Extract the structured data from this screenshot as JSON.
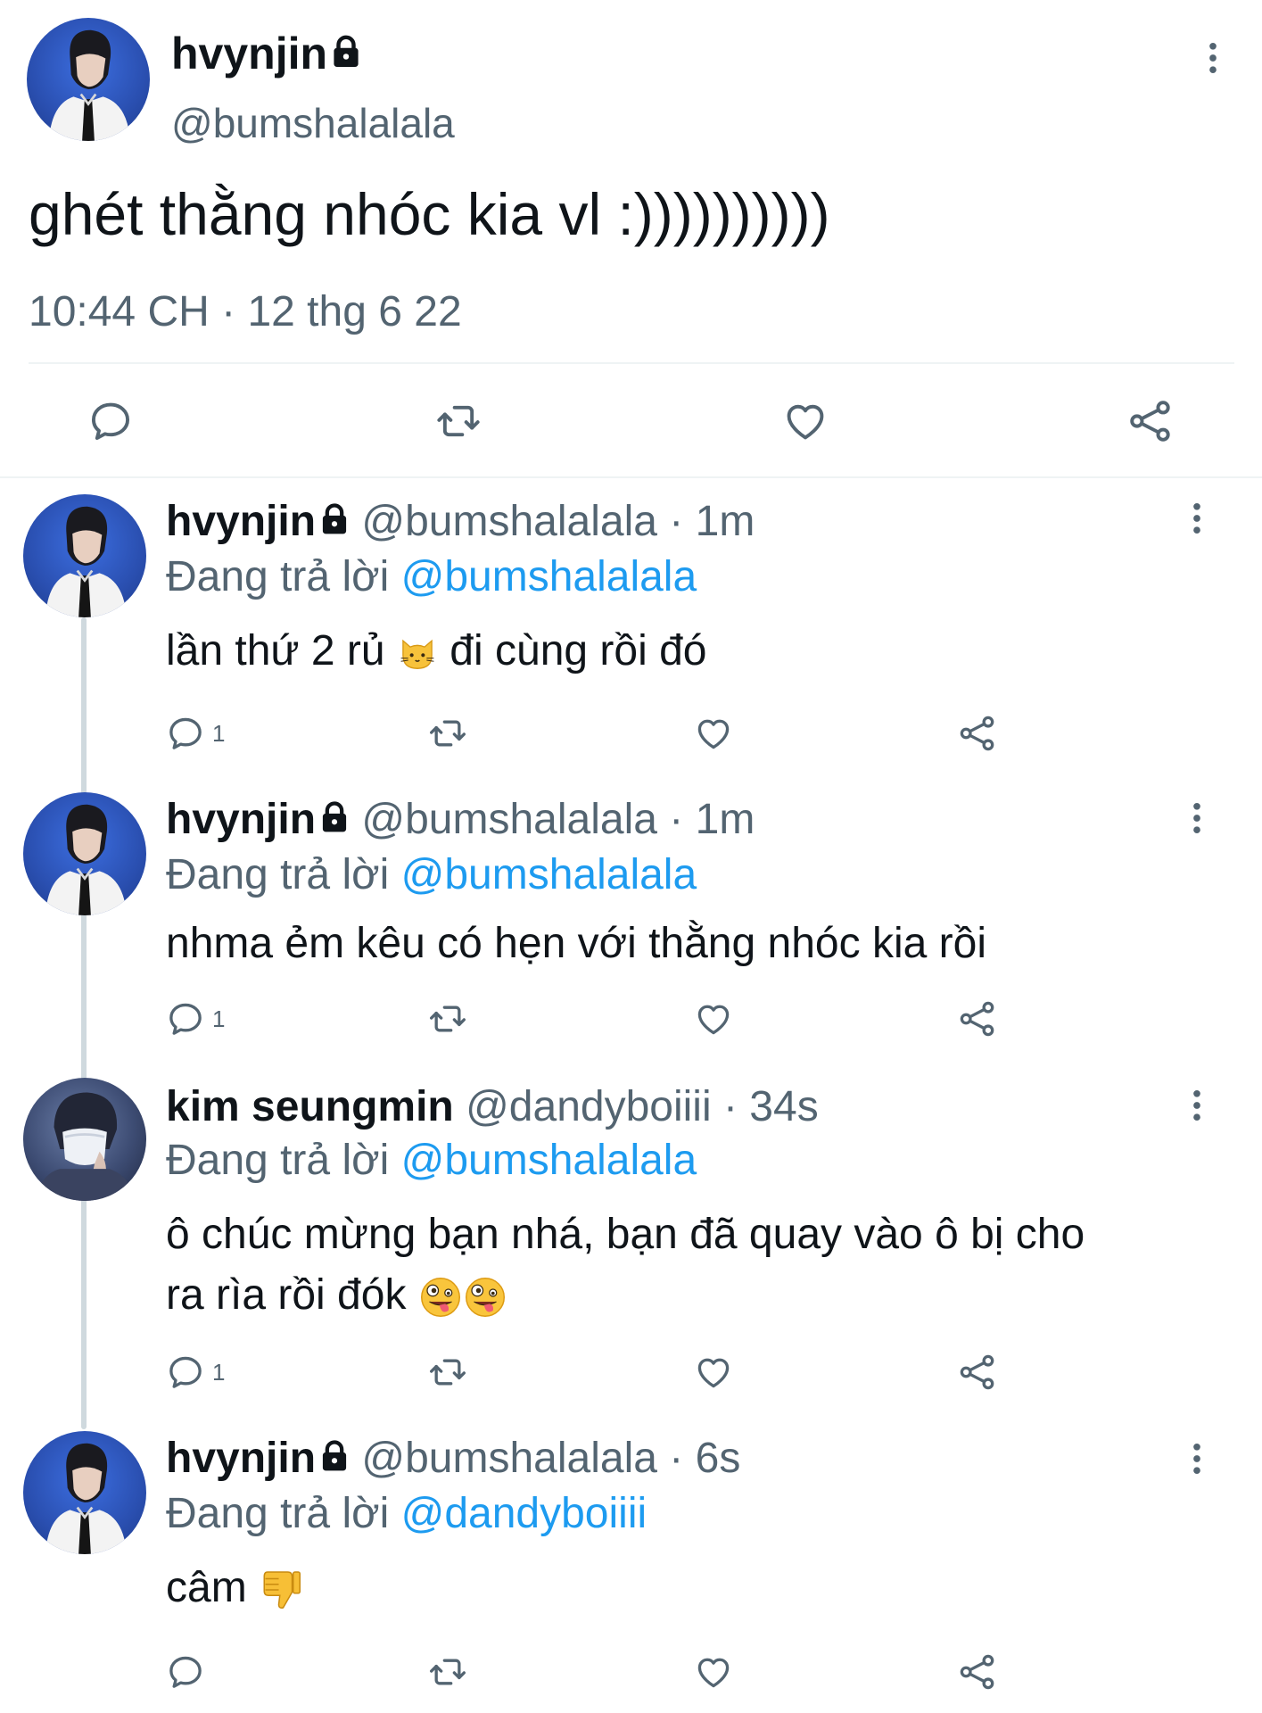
{
  "main_tweet": {
    "display_name": "hvynjin",
    "handle": "@bumshalalala",
    "text": "ghét thằng nhóc kia vl :))))))))))",
    "timestamp": "10:44 CH · 12 thg 6 22"
  },
  "replies": [
    {
      "display_name": "hvynjin",
      "handle": "@bumshalalala",
      "time": "· 1m",
      "replying_label": "Đang trả lời",
      "replying_to": "@bumshalalala",
      "text_before": "lần thứ 2 rủ",
      "text_after": "đi cùng rồi đó",
      "reply_count": "1"
    },
    {
      "display_name": "hvynjin",
      "handle": "@bumshalalala",
      "time": "· 1m",
      "replying_label": "Đang trả lời",
      "replying_to": "@bumshalalala",
      "text": "nhma ẻm kêu có hẹn với thằng nhóc kia rồi",
      "reply_count": "1"
    },
    {
      "display_name": "kim seungmin",
      "handle": "@dandyboiiii",
      "time": "· 34s",
      "replying_label": "Đang trả lời",
      "replying_to": "@bumshalalala",
      "text_line1": "ô chúc mừng bạn nhá, bạn đã quay vào ô bị cho",
      "text_line2": "ra rìa rồi đók",
      "reply_count": "1"
    },
    {
      "display_name": "hvynjin",
      "handle": "@bumshalalala",
      "time": "· 6s",
      "replying_label": "Đang trả lời",
      "replying_to": "@dandyboiiii",
      "text": "câm"
    }
  ],
  "icons": {
    "lock": "lock-icon",
    "more": "more-vertical-icon",
    "reply": "reply-icon",
    "retweet": "retweet-icon",
    "like": "heart-icon",
    "share": "share-icon",
    "cat": "cat-face-emoji",
    "zany": "zany-face-emoji",
    "thumbs_down": "thumbs-down-emoji"
  },
  "colors": {
    "link": "#1d9bf0",
    "muted": "#536471",
    "text": "#0f1419",
    "divider": "#eff3f4",
    "thread_line": "#cfd9de"
  }
}
